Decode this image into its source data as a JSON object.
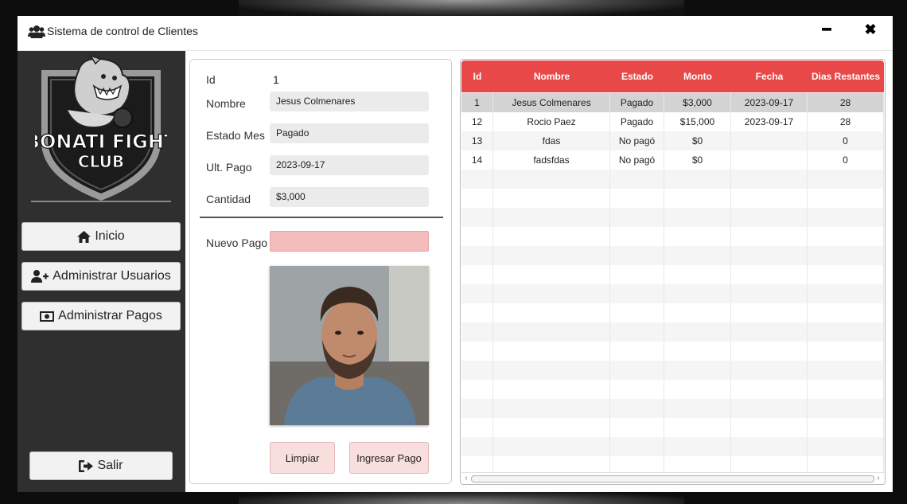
{
  "window": {
    "title": "Sistema de control de Clientes",
    "minimize_label": "━",
    "close_label": "✖"
  },
  "sidebar": {
    "logo_text_line1": "BONATI FIGHT",
    "logo_text_line2": "CLUB",
    "items": [
      {
        "label": "Inicio",
        "icon": "home-icon"
      },
      {
        "label": "Administrar Usuarios",
        "icon": "user-plus-icon"
      },
      {
        "label": "Administrar Pagos",
        "icon": "money-icon"
      }
    ],
    "logout_label": "Salir"
  },
  "form": {
    "id_label": "Id",
    "id_value": "1",
    "nombre_label": "Nombre",
    "nombre_value": "Jesus Colmenares",
    "estado_label": "Estado Mes",
    "estado_value": "Pagado",
    "ult_pago_label": "Ult. Pago",
    "ult_pago_value": "2023-09-17",
    "cantidad_label": "Cantidad",
    "cantidad_value": "$3,000",
    "nuevo_pago_label": "Nuevo Pago",
    "nuevo_pago_value": "",
    "limpiar_label": "Limpiar",
    "ingresar_label": "Ingresar Pago"
  },
  "table": {
    "columns": [
      "Id",
      "Nombre",
      "Estado",
      "Monto",
      "Fecha",
      "Dias Restantes"
    ],
    "rows": [
      [
        "1",
        "Jesus Colmenares",
        "Pagado",
        "$3,000",
        "2023-09-17",
        "28"
      ],
      [
        "12",
        "Rocio Paez",
        "Pagado",
        "$15,000",
        "2023-09-17",
        "28"
      ],
      [
        "13",
        "fdas",
        "No pagó",
        "$0",
        "",
        "0"
      ],
      [
        "14",
        "fadsfdas",
        "No pagó",
        "$0",
        "",
        "0"
      ]
    ],
    "selected_row": 0
  },
  "colors": {
    "header": "#e84848",
    "sidebar": "#2f2f2f",
    "input_highlight": "#f5bcbc"
  }
}
